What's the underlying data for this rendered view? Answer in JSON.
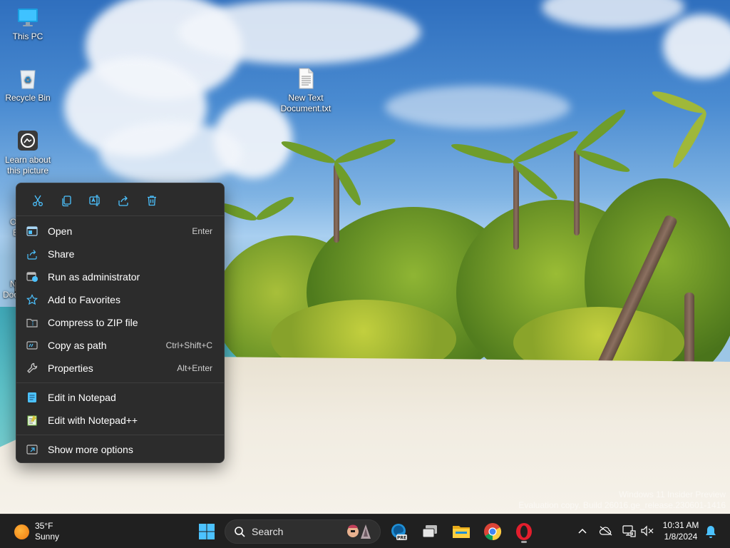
{
  "desktop": {
    "icons": [
      {
        "label": "This PC",
        "icon": "monitor-icon"
      },
      {
        "label": "Recycle Bin",
        "icon": "recycle-bin-icon"
      },
      {
        "label": "Learn about this picture",
        "icon": "camera-icon"
      },
      {
        "label": "New Text Document.txt",
        "icon": "text-file-icon"
      }
    ],
    "partial_icons": [
      "O",
      "E",
      "N",
      "Doc"
    ],
    "watermark_line1": "Windows 11 Insider Preview",
    "watermark_line2": "Evaluation copy. Build 26016.ge_release.230601-1416"
  },
  "context_menu": {
    "quick_actions": [
      {
        "name": "cut",
        "icon": "scissors-icon"
      },
      {
        "name": "copy",
        "icon": "copy-icon"
      },
      {
        "name": "rename",
        "icon": "rename-icon"
      },
      {
        "name": "share",
        "icon": "share-icon"
      },
      {
        "name": "delete",
        "icon": "trash-icon"
      }
    ],
    "items": [
      {
        "label": "Open",
        "shortcut": "Enter",
        "icon": "open-icon"
      },
      {
        "label": "Share",
        "shortcut": "",
        "icon": "share-icon"
      },
      {
        "label": "Run as administrator",
        "shortcut": "",
        "icon": "admin-shield-icon"
      },
      {
        "label": "Add to Favorites",
        "shortcut": "",
        "icon": "star-icon"
      },
      {
        "label": "Compress to ZIP file",
        "shortcut": "",
        "icon": "zip-icon"
      },
      {
        "label": "Copy as path",
        "shortcut": "Ctrl+Shift+C",
        "icon": "copy-path-icon"
      },
      {
        "label": "Properties",
        "shortcut": "Alt+Enter",
        "icon": "wrench-icon"
      },
      {
        "label": "Edit in Notepad",
        "shortcut": "",
        "icon": "notepad-icon"
      },
      {
        "label": "Edit with Notepad++",
        "shortcut": "",
        "icon": "notepadpp-icon"
      },
      {
        "label": "Show more options",
        "shortcut": "",
        "icon": "more-options-icon"
      }
    ]
  },
  "taskbar": {
    "weather": {
      "temp": "35°F",
      "condition": "Sunny",
      "icon": "sun-icon"
    },
    "search_label": "Search",
    "apps": [
      "start-icon",
      "edge-beta-icon",
      "task-view-icon",
      "file-explorer-icon",
      "chrome-icon",
      "opera-icon"
    ],
    "edge_badge": "PRE",
    "clock": {
      "time": "10:31 AM",
      "date": "1/8/2024"
    },
    "tray": [
      "chevron-up-icon",
      "onedrive-icon",
      "network-icon",
      "volume-muted-icon",
      "notification-bell-icon"
    ]
  },
  "colors": {
    "taskbar": "#202020",
    "menu_bg": "#2c2c2c",
    "accent": "#4cc2ff"
  }
}
